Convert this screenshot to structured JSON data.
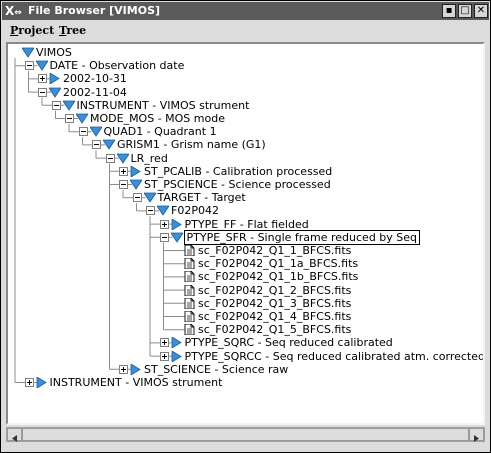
{
  "window": {
    "title": "File Browser [VIMOS]",
    "controls": [
      "minimize",
      "maximize",
      "close"
    ]
  },
  "menu": {
    "items": [
      {
        "label": "Project",
        "mnemonic": "P"
      },
      {
        "label": "Tree",
        "mnemonic": "T"
      }
    ]
  },
  "tree": {
    "nodes": [
      {
        "label": "VIMOS",
        "icon": "folder-open-icon",
        "expander": "none"
      },
      {
        "label": "DATE - Observation date",
        "icon": "folder-open-icon",
        "expander": "minus"
      },
      {
        "label": "2002-10-31",
        "icon": "folder-closed-icon",
        "expander": "plus"
      },
      {
        "label": "2002-11-04",
        "icon": "folder-open-icon",
        "expander": "minus"
      },
      {
        "label": "INSTRUMENT - VIMOS strument",
        "icon": "folder-open-icon",
        "expander": "minus"
      },
      {
        "label": "MODE_MOS - MOS mode",
        "icon": "folder-open-icon",
        "expander": "minus"
      },
      {
        "label": "QUAD1 - Quadrant 1",
        "icon": "folder-open-icon",
        "expander": "minus"
      },
      {
        "label": "GRISM1 - Grism name (G1)",
        "icon": "folder-open-icon",
        "expander": "minus"
      },
      {
        "label": "LR_red",
        "icon": "folder-open-icon",
        "expander": "minus"
      },
      {
        "label": "ST_PCALIB - Calibration processed",
        "icon": "folder-closed-icon",
        "expander": "plus"
      },
      {
        "label": "ST_PSCIENCE - Science processed",
        "icon": "folder-open-icon",
        "expander": "minus"
      },
      {
        "label": "TARGET - Target",
        "icon": "folder-open-icon",
        "expander": "minus"
      },
      {
        "label": "F02P042",
        "icon": "folder-open-icon",
        "expander": "minus"
      },
      {
        "label": "PTYPE_FF - Flat fielded",
        "icon": "folder-closed-icon",
        "expander": "plus"
      },
      {
        "label": "PTYPE_SFR - Single frame reduced by Seq",
        "icon": "folder-open-icon",
        "expander": "minus",
        "selected": true
      },
      {
        "label": "sc_F02P042_Q1_1_BFCS.fits",
        "icon": "file-icon",
        "expander": "none"
      },
      {
        "label": "sc_F02P042_Q1_1a_BFCS.fits",
        "icon": "file-icon",
        "expander": "none"
      },
      {
        "label": "sc_F02P042_Q1_1b_BFCS.fits",
        "icon": "file-icon",
        "expander": "none"
      },
      {
        "label": "sc_F02P042_Q1_2_BFCS.fits",
        "icon": "file-icon",
        "expander": "none"
      },
      {
        "label": "sc_F02P042_Q1_3_BFCS.fits",
        "icon": "file-icon",
        "expander": "none"
      },
      {
        "label": "sc_F02P042_Q1_4_BFCS.fits",
        "icon": "file-icon",
        "expander": "none"
      },
      {
        "label": "sc_F02P042_Q1_5_BFCS.fits",
        "icon": "file-icon",
        "expander": "none"
      },
      {
        "label": "PTYPE_SQRC - Seq reduced calibrated",
        "icon": "folder-closed-icon",
        "expander": "plus"
      },
      {
        "label": "PTYPE_SQRCC - Seq reduced calibrated atm. corrected",
        "icon": "folder-closed-icon",
        "expander": "plus"
      },
      {
        "label": "ST_SCIENCE - Science raw",
        "icon": "folder-closed-icon",
        "expander": "plus"
      },
      {
        "label": "INSTRUMENT - VIMOS strument",
        "icon": "folder-closed-icon",
        "expander": "plus"
      }
    ]
  },
  "colors": {
    "titlebar": "#5a5a5a",
    "folder_icon": "#3a8fd8",
    "tree_background": "#ffffff",
    "window_background": "#dcdcdc"
  }
}
